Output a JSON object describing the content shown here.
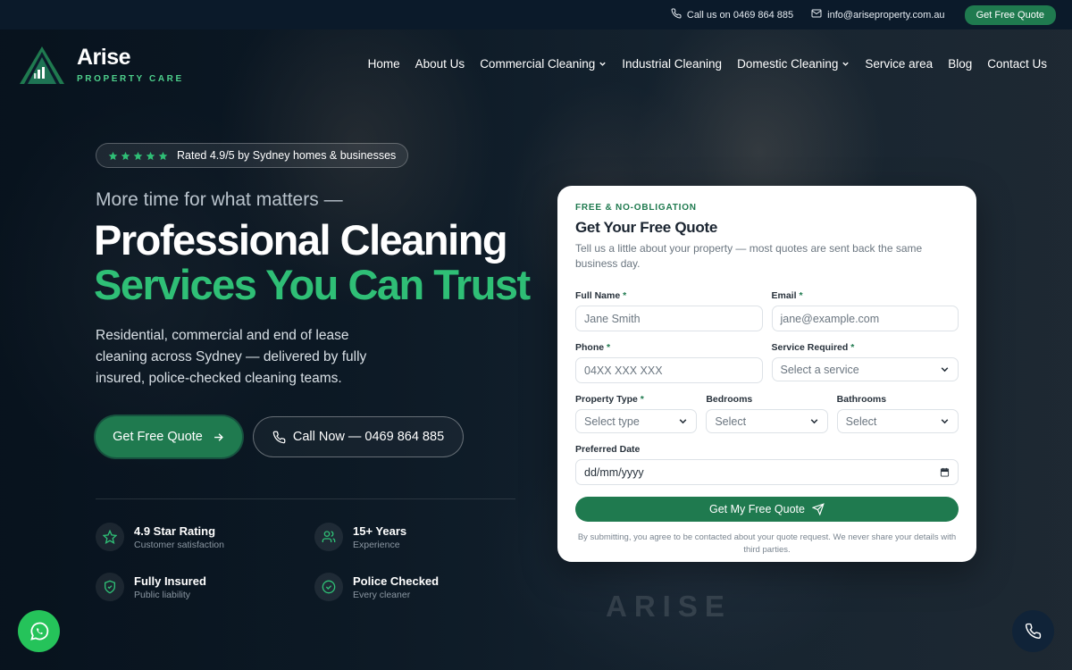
{
  "topbar": {
    "phone_text": "Call us on 0469 864 885",
    "email_text": "info@ariseproperty.com.au",
    "quote_button": "Get Free Quote"
  },
  "brand": {
    "name": "Arise",
    "tagline": "PROPERTY CARE"
  },
  "nav": [
    {
      "label": "Home",
      "dropdown": false
    },
    {
      "label": "About Us",
      "dropdown": false
    },
    {
      "label": "Commercial Cleaning",
      "dropdown": true
    },
    {
      "label": "Industrial Cleaning",
      "dropdown": false
    },
    {
      "label": "Domestic Cleaning",
      "dropdown": true
    },
    {
      "label": "Service area",
      "dropdown": false
    },
    {
      "label": "Blog",
      "dropdown": false
    },
    {
      "label": "Contact Us",
      "dropdown": false
    }
  ],
  "hero": {
    "rating_text": "Rated 4.9/5 by Sydney homes & businesses",
    "stars": 5,
    "kicker": "More time for what matters —",
    "title_line1": "Professional Cleaning",
    "title_line2": "Services You Can Trust",
    "lead": "Residential, commercial and end of lease cleaning across Sydney — delivered by fully insured, police-checked cleaning teams.",
    "primary_cta": "Get Free Quote",
    "secondary_cta": "Call Now — 0469 864 885"
  },
  "stats": [
    {
      "icon": "star-icon",
      "title": "4.9 Star Rating",
      "subtitle": "Customer satisfaction"
    },
    {
      "icon": "users-icon",
      "title": "15+ Years",
      "subtitle": "Experience"
    },
    {
      "icon": "shield-check-icon",
      "title": "Fully Insured",
      "subtitle": "Public liability"
    },
    {
      "icon": "check-circle-icon",
      "title": "Police Checked",
      "subtitle": "Every cleaner"
    }
  ],
  "form": {
    "eyebrow": "FREE & NO-OBLIGATION",
    "title": "Get Your Free Quote",
    "description": "Tell us a little about your property — most quotes are sent back the same business day.",
    "full_name": {
      "label": "Full Name",
      "placeholder": "Jane Smith"
    },
    "email": {
      "label": "Email",
      "placeholder": "jane@example.com"
    },
    "phone": {
      "label": "Phone",
      "placeholder": "04XX XXX XXX"
    },
    "service": {
      "label": "Service Required",
      "value": "Select a service"
    },
    "property_type": {
      "label": "Property Type",
      "value": "Select type"
    },
    "bedrooms": {
      "label": "Bedrooms",
      "value": "Select"
    },
    "bathrooms": {
      "label": "Bathrooms",
      "value": "Select"
    },
    "date": {
      "label": "Preferred Date",
      "placeholder": "dd/mm/yyyy"
    },
    "required_mark": "*",
    "submit": "Get My Free Quote",
    "disclaimer": "By submitting, you agree to be contacted about your quote request. We never share your details with third parties."
  },
  "watermark": "ARISE",
  "colors": {
    "brand_green": "#1f7a4f",
    "accent_green": "#2fbf76",
    "topbar_bg": "#0b1a2a",
    "whatsapp": "#25c35a"
  }
}
